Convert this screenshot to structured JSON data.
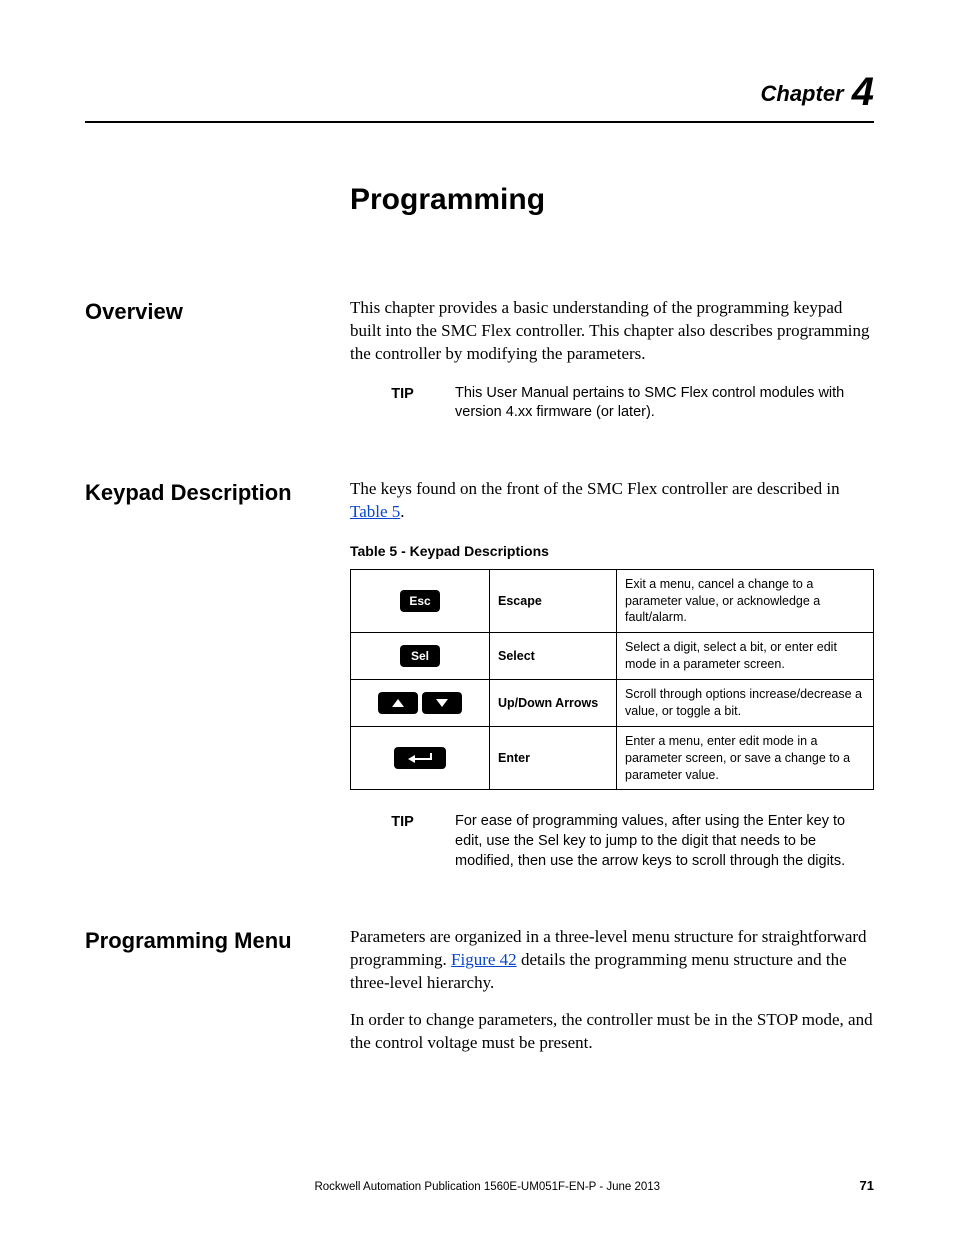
{
  "chapter": {
    "label": "Chapter",
    "number": "4"
  },
  "title": "Programming",
  "sections": {
    "overview": {
      "heading": "Overview",
      "para": "This chapter provides a basic understanding of the programming keypad built into the SMC Flex controller. This chapter also describes programming the controller by modifying the parameters.",
      "tip_label": "TIP",
      "tip_text": "This User Manual pertains to SMC Flex control modules with version 4.xx firmware (or later)."
    },
    "keypad": {
      "heading": "Keypad Description",
      "para_pre": "The keys found on the front of the SMC Flex controller are described in ",
      "para_link": "Table 5",
      "para_post": ".",
      "table_caption": "Table 5 - Keypad Descriptions",
      "rows": [
        {
          "key_label": "Esc",
          "name": "Escape",
          "desc": "Exit a menu, cancel a change to a parameter value, or acknowledge a fault/alarm."
        },
        {
          "key_label": "Sel",
          "name": "Select",
          "desc": "Select a digit, select a bit, or enter edit mode in a parameter screen."
        },
        {
          "key_label": "",
          "name": "Up/Down Arrows",
          "desc": "Scroll through options increase/decrease a value, or toggle a bit."
        },
        {
          "key_label": "",
          "name": "Enter",
          "desc": "Enter a menu, enter edit mode in a parameter screen, or save a change to a parameter value."
        }
      ],
      "tip_label": "TIP",
      "tip_text": "For ease of programming values, after using the Enter key to edit, use the Sel key to jump to the digit that needs to be modified, then use the arrow keys to scroll through the digits."
    },
    "menu": {
      "heading": "Programming Menu",
      "para1_pre": "Parameters are organized in a three-level menu structure for straightforward programming. ",
      "para1_link": "Figure 42",
      "para1_post": " details the programming menu structure and the three-level hierarchy.",
      "para2": "In order to change parameters, the controller must be in the STOP mode, and the control voltage must be present."
    }
  },
  "footer": {
    "publication": "Rockwell Automation Publication 1560E-UM051F-EN-P - June 2013",
    "page": "71"
  }
}
